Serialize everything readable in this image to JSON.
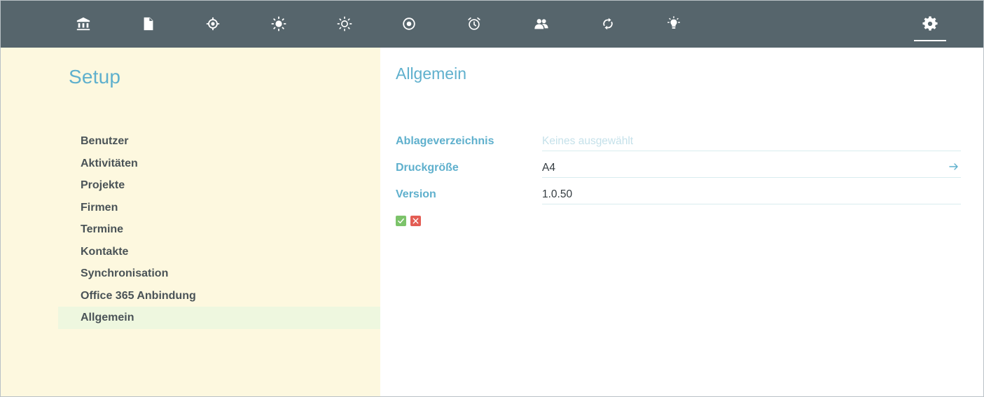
{
  "topbar": {
    "icons": [
      {
        "name": "bank-icon"
      },
      {
        "name": "document-icon"
      },
      {
        "name": "target-icon"
      },
      {
        "name": "sun-filled-icon"
      },
      {
        "name": "sun-outline-icon"
      },
      {
        "name": "lifebuoy-icon"
      },
      {
        "name": "alarm-clock-icon"
      },
      {
        "name": "users-icon"
      },
      {
        "name": "sync-icon"
      },
      {
        "name": "lightbulb-icon"
      },
      {
        "name": "gear-icon",
        "active": true
      }
    ],
    "background": "#56656c",
    "icon_color": "#ffffff"
  },
  "sidebar": {
    "title": "Setup",
    "items": [
      {
        "label": "Benutzer"
      },
      {
        "label": "Aktivitäten"
      },
      {
        "label": "Projekte"
      },
      {
        "label": "Firmen"
      },
      {
        "label": "Termine"
      },
      {
        "label": "Kontakte"
      },
      {
        "label": "Synchronisation"
      },
      {
        "label": "Office 365 Anbindung"
      },
      {
        "label": "Allgemein",
        "active": true
      }
    ],
    "background": "#fdf8df",
    "active_background": "#eef7df"
  },
  "main": {
    "title": "Allgemein",
    "fields": [
      {
        "label": "Ablageverzeichnis",
        "value": "",
        "placeholder": "Keines ausgewählt"
      },
      {
        "label": "Druckgröße",
        "value": "A4",
        "has_arrow": true
      },
      {
        "label": "Version",
        "value": "1.0.50"
      }
    ],
    "actions": {
      "confirm_icon": "check-icon",
      "cancel_icon": "close-icon"
    }
  },
  "colors": {
    "accent": "#5fb0cd",
    "text": "#4a5357",
    "success": "#7cc36a",
    "danger": "#e35d54"
  }
}
